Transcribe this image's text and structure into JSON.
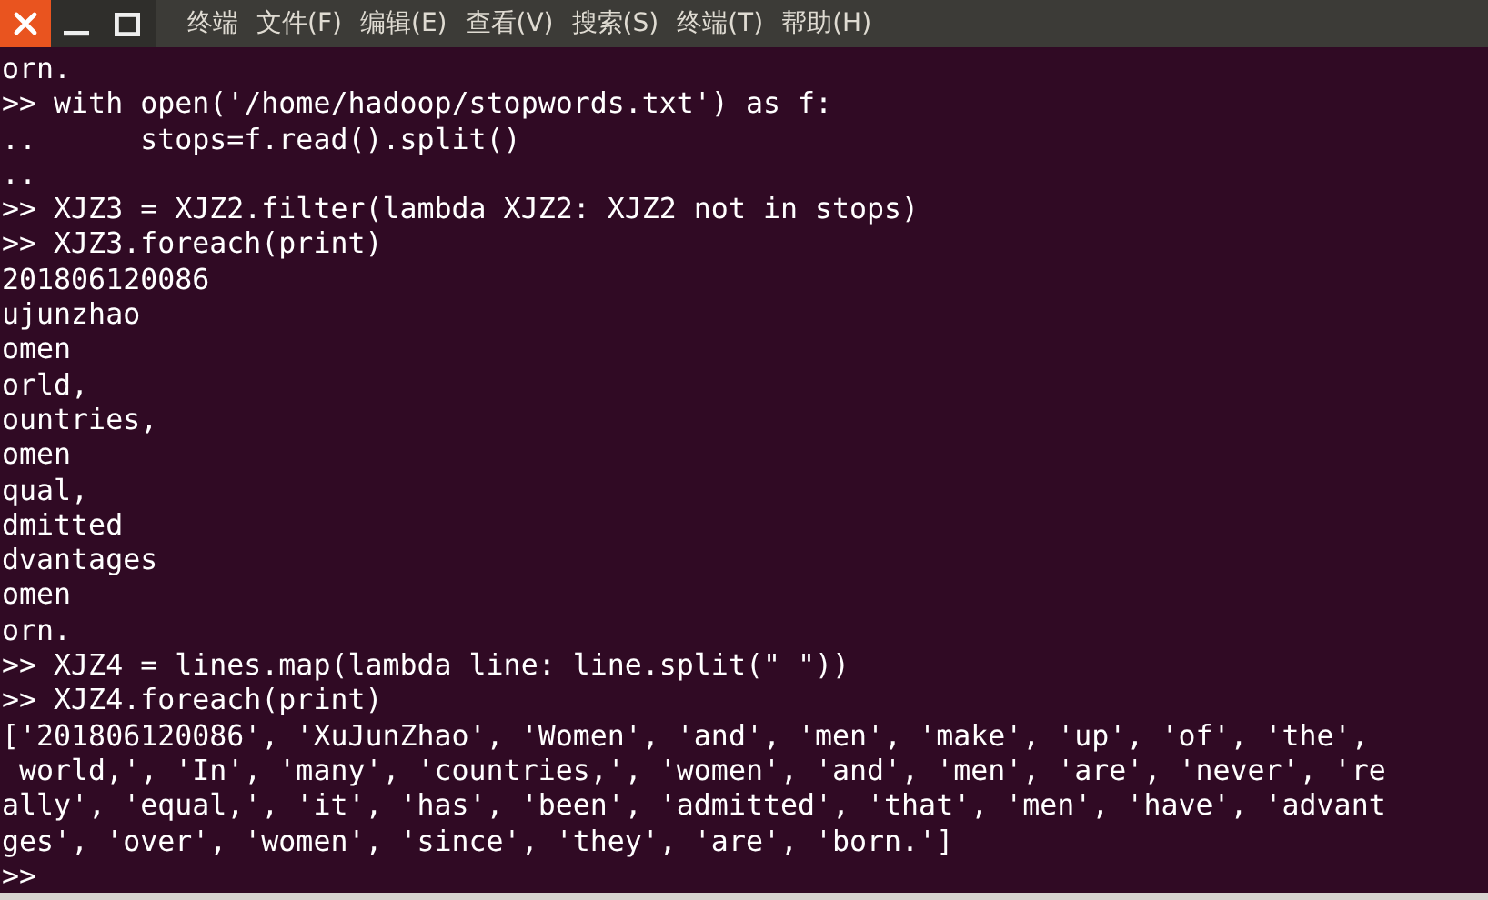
{
  "menu": [
    "终端",
    "文件(F)",
    "编辑(E)",
    "查看(V)",
    "搜索(S)",
    "终端(T)",
    "帮助(H)"
  ],
  "terminal": {
    "lines": [
      "orn.",
      ">> with open('/home/hadoop/stopwords.txt') as f:",
      "..      stops=f.read().split()",
      "..",
      ">> XJZ3 = XJZ2.filter(lambda XJZ2: XJZ2 not in stops)",
      ">> XJZ3.foreach(print)",
      "201806120086",
      "ujunzhao",
      "omen",
      "orld,",
      "ountries,",
      "omen",
      "qual,",
      "dmitted",
      "dvantages",
      "omen",
      "orn.",
      ">> XJZ4 = lines.map(lambda line: line.split(\" \"))",
      ">> XJZ4.foreach(print)",
      "['201806120086', 'XuJunZhao', 'Women', 'and', 'men', 'make', 'up', 'of', 'the',",
      " world,', 'In', 'many', 'countries,', 'women', 'and', 'men', 'are', 'never', 're",
      "ally', 'equal,', 'it', 'has', 'been', 'admitted', 'that', 'men', 'have', 'advant",
      "ges', 'over', 'women', 'since', 'they', 'are', 'born.']",
      ">>"
    ]
  }
}
